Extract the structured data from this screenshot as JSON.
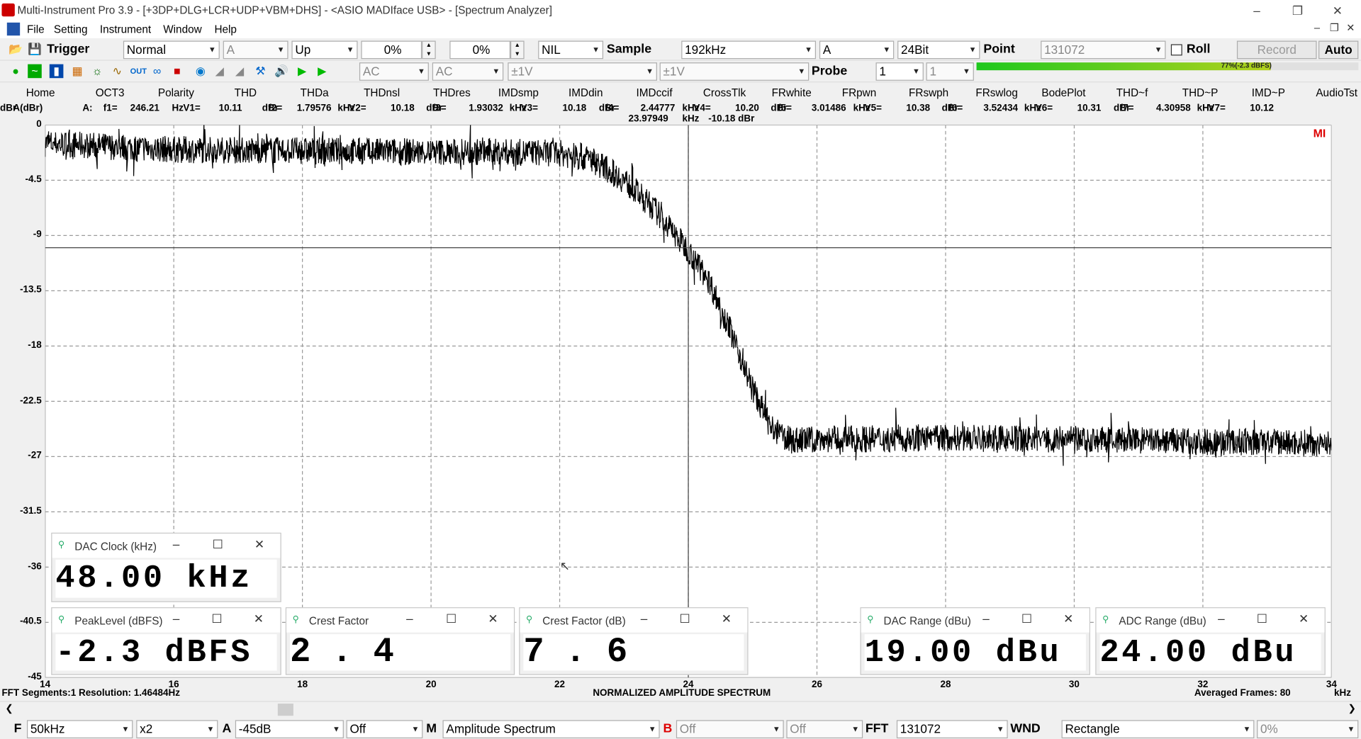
{
  "window": {
    "title": "Multi-Instrument Pro 3.9   -   [+3DP+DLG+LCR+UDP+VBM+DHS]   -   <ASIO MADIface USB> - [Spectrum Analyzer]"
  },
  "menu": [
    "File",
    "Setting",
    "Instrument",
    "Window",
    "Help"
  ],
  "toolbar1": {
    "trigger_label": "Trigger",
    "trigger_mode": "Normal",
    "trigger_channel": "A",
    "trigger_edge": "Up",
    "pct1": "0%",
    "pct2": "0%",
    "nil": "NIL",
    "sample_label": "Sample",
    "sample_rate": "192kHz",
    "channel": "A",
    "bits": "24Bit",
    "point_label": "Point",
    "point": "131072",
    "roll_label": "Roll",
    "record_label": "Record",
    "auto_label": "Auto"
  },
  "toolbar2": {
    "couple_a": "AC",
    "couple_b": "AC",
    "range_a": "±1V",
    "range_b": "±1V",
    "probe_label": "Probe",
    "probe_a": "1",
    "probe_b": "1",
    "level_meter": "77%(-2.3 dBFS)"
  },
  "tabs": [
    "Home",
    "OCT3",
    "Polarity",
    "THD",
    "THDa",
    "THDnsl",
    "THDres",
    "IMDsmp",
    "IMDdin",
    "IMDccif",
    "CrossTlk",
    "FRwhite",
    "FRpwn",
    "FRswph",
    "FRswlog",
    "BodePlot",
    "THD~f",
    "THD~P",
    "IMD~P",
    "AudioTst"
  ],
  "readout": {
    "unit": "A(dBr)",
    "values": [
      "A:",
      "f1=",
      "246.21",
      "Hz",
      "V1=",
      "10.11",
      "dBr",
      "f2=",
      "1.79576",
      "kHz",
      "V2=",
      "10.18",
      "dBr",
      "f3=",
      "1.93032",
      "kHz",
      "V3=",
      "10.18",
      "dBr",
      "f4=",
      "2.44777",
      "kHz",
      "V4=",
      "10.20",
      "dBr",
      "f5=",
      "3.01486",
      "kHz",
      "V5=",
      "10.38",
      "dBr",
      "f6=",
      "3.52434",
      "kHz",
      "V6=",
      "10.31",
      "dBr",
      "f7=",
      "4.30958",
      "kHz",
      "V7=",
      "10.12",
      "dBr"
    ],
    "cursor_f": "23.97949",
    "cursor_f_unit": "kHz",
    "cursor_v": "-10.18 dBr"
  },
  "chart_data": {
    "type": "line",
    "title": "NORMALIZED AMPLITUDE SPECTRUM",
    "x_unit": "kHz",
    "ylim": [
      -45,
      0
    ],
    "xlim": [
      14,
      34
    ],
    "yticks": [
      "0",
      "-4.5",
      "-9",
      "-13.5",
      "-18",
      "-22.5",
      "-27",
      "-31.5",
      "-36",
      "-40.5",
      "-45"
    ],
    "xticks": [
      "14",
      "16",
      "18",
      "20",
      "22",
      "24",
      "26",
      "28",
      "30",
      "32",
      "34"
    ],
    "grid": true,
    "cursor_x": 24,
    "cursor_y": -10,
    "series": [
      {
        "x": [
          14,
          16,
          18,
          20,
          21,
          22,
          22.5,
          23,
          23.5,
          23.8,
          24,
          24.3,
          24.6,
          25,
          25.3,
          25.6,
          26,
          28,
          30,
          32,
          34
        ],
        "y": [
          -1.5,
          -2,
          -2.1,
          -2.2,
          -2.2,
          -2.3,
          -2.8,
          -4.5,
          -7,
          -9,
          -10.2,
          -12.5,
          -16,
          -21.5,
          -24.8,
          -25.7,
          -25.6,
          -25.5,
          -25.6,
          -25.8,
          -25.9
        ]
      }
    ]
  },
  "status": {
    "segments": "FFT Segments:1   Resolution: 1.46484Hz",
    "averaged": "Averaged Frames: 80",
    "logo": "MI"
  },
  "panels": {
    "dac_clock": {
      "title": "DAC Clock (kHz)",
      "value": "48.00 kHz"
    },
    "peak_level": {
      "title": "PeakLevel (dBFS)",
      "value": "-2.3 dBFS"
    },
    "crest": {
      "title": "Crest Factor",
      "value": "2.4"
    },
    "crest_db": {
      "title": "Crest Factor (dB)",
      "value": "7.6"
    },
    "dac_range": {
      "title": "DAC Range (dBu)",
      "value": "19.00 dBu"
    },
    "adc_range": {
      "title": "ADC Range (dBu)",
      "value": "24.00 dBu"
    }
  },
  "bottom": {
    "f_label": "F",
    "f_value": "50kHz",
    "zoom": "x2",
    "a_label": "A",
    "a_value": "-45dB",
    "a_off": "Off",
    "m_label": "M",
    "m_value": "Amplitude Spectrum",
    "b_label": "B",
    "b_value": "Off",
    "b_off": "Off",
    "fft_label": "FFT",
    "fft_value": "131072",
    "wnd_label": "WND",
    "wnd_value": "Rectangle",
    "pct": "0%"
  }
}
